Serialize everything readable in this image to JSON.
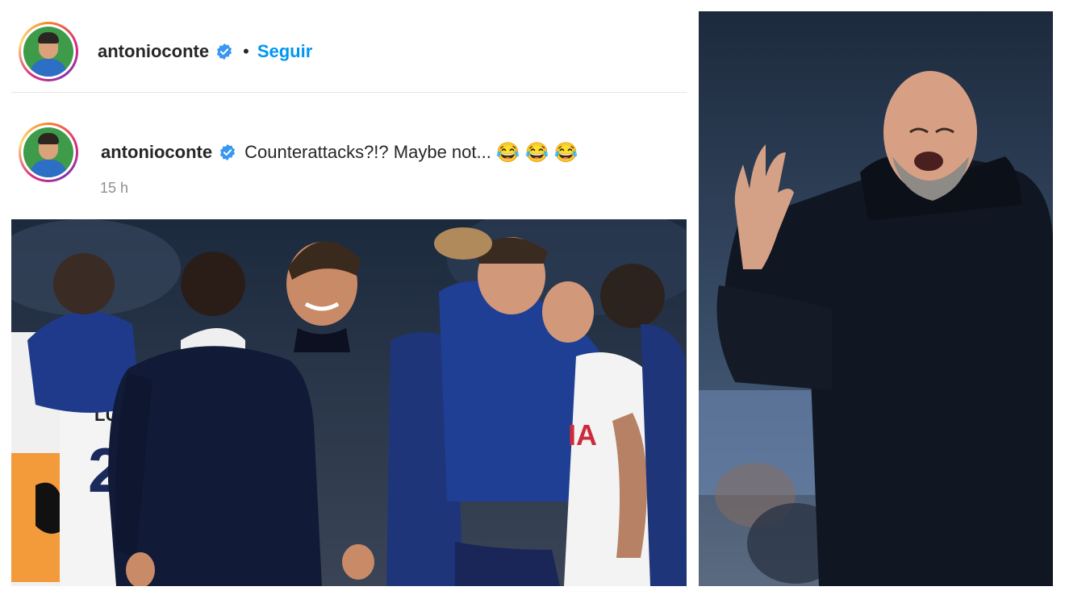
{
  "post": {
    "username": "antonioconte",
    "separator": "•",
    "follow_label": "Seguir",
    "caption_username": "antonioconte",
    "caption_text": "Counterattacks?!? Maybe not...",
    "caption_emojis": [
      "😂",
      "😂",
      "😂"
    ],
    "timestamp": "15 h"
  },
  "photo": {
    "jersey_name": "LUCAS",
    "jersey_number": "27",
    "jersey_partial": "IA"
  },
  "colors": {
    "follow_blue": "#0095f6",
    "verified_blue": "#3897f0",
    "text_dark": "#262626",
    "muted_gray": "#8e8e8e"
  },
  "icons": [
    "verified-icon",
    "avatar"
  ]
}
